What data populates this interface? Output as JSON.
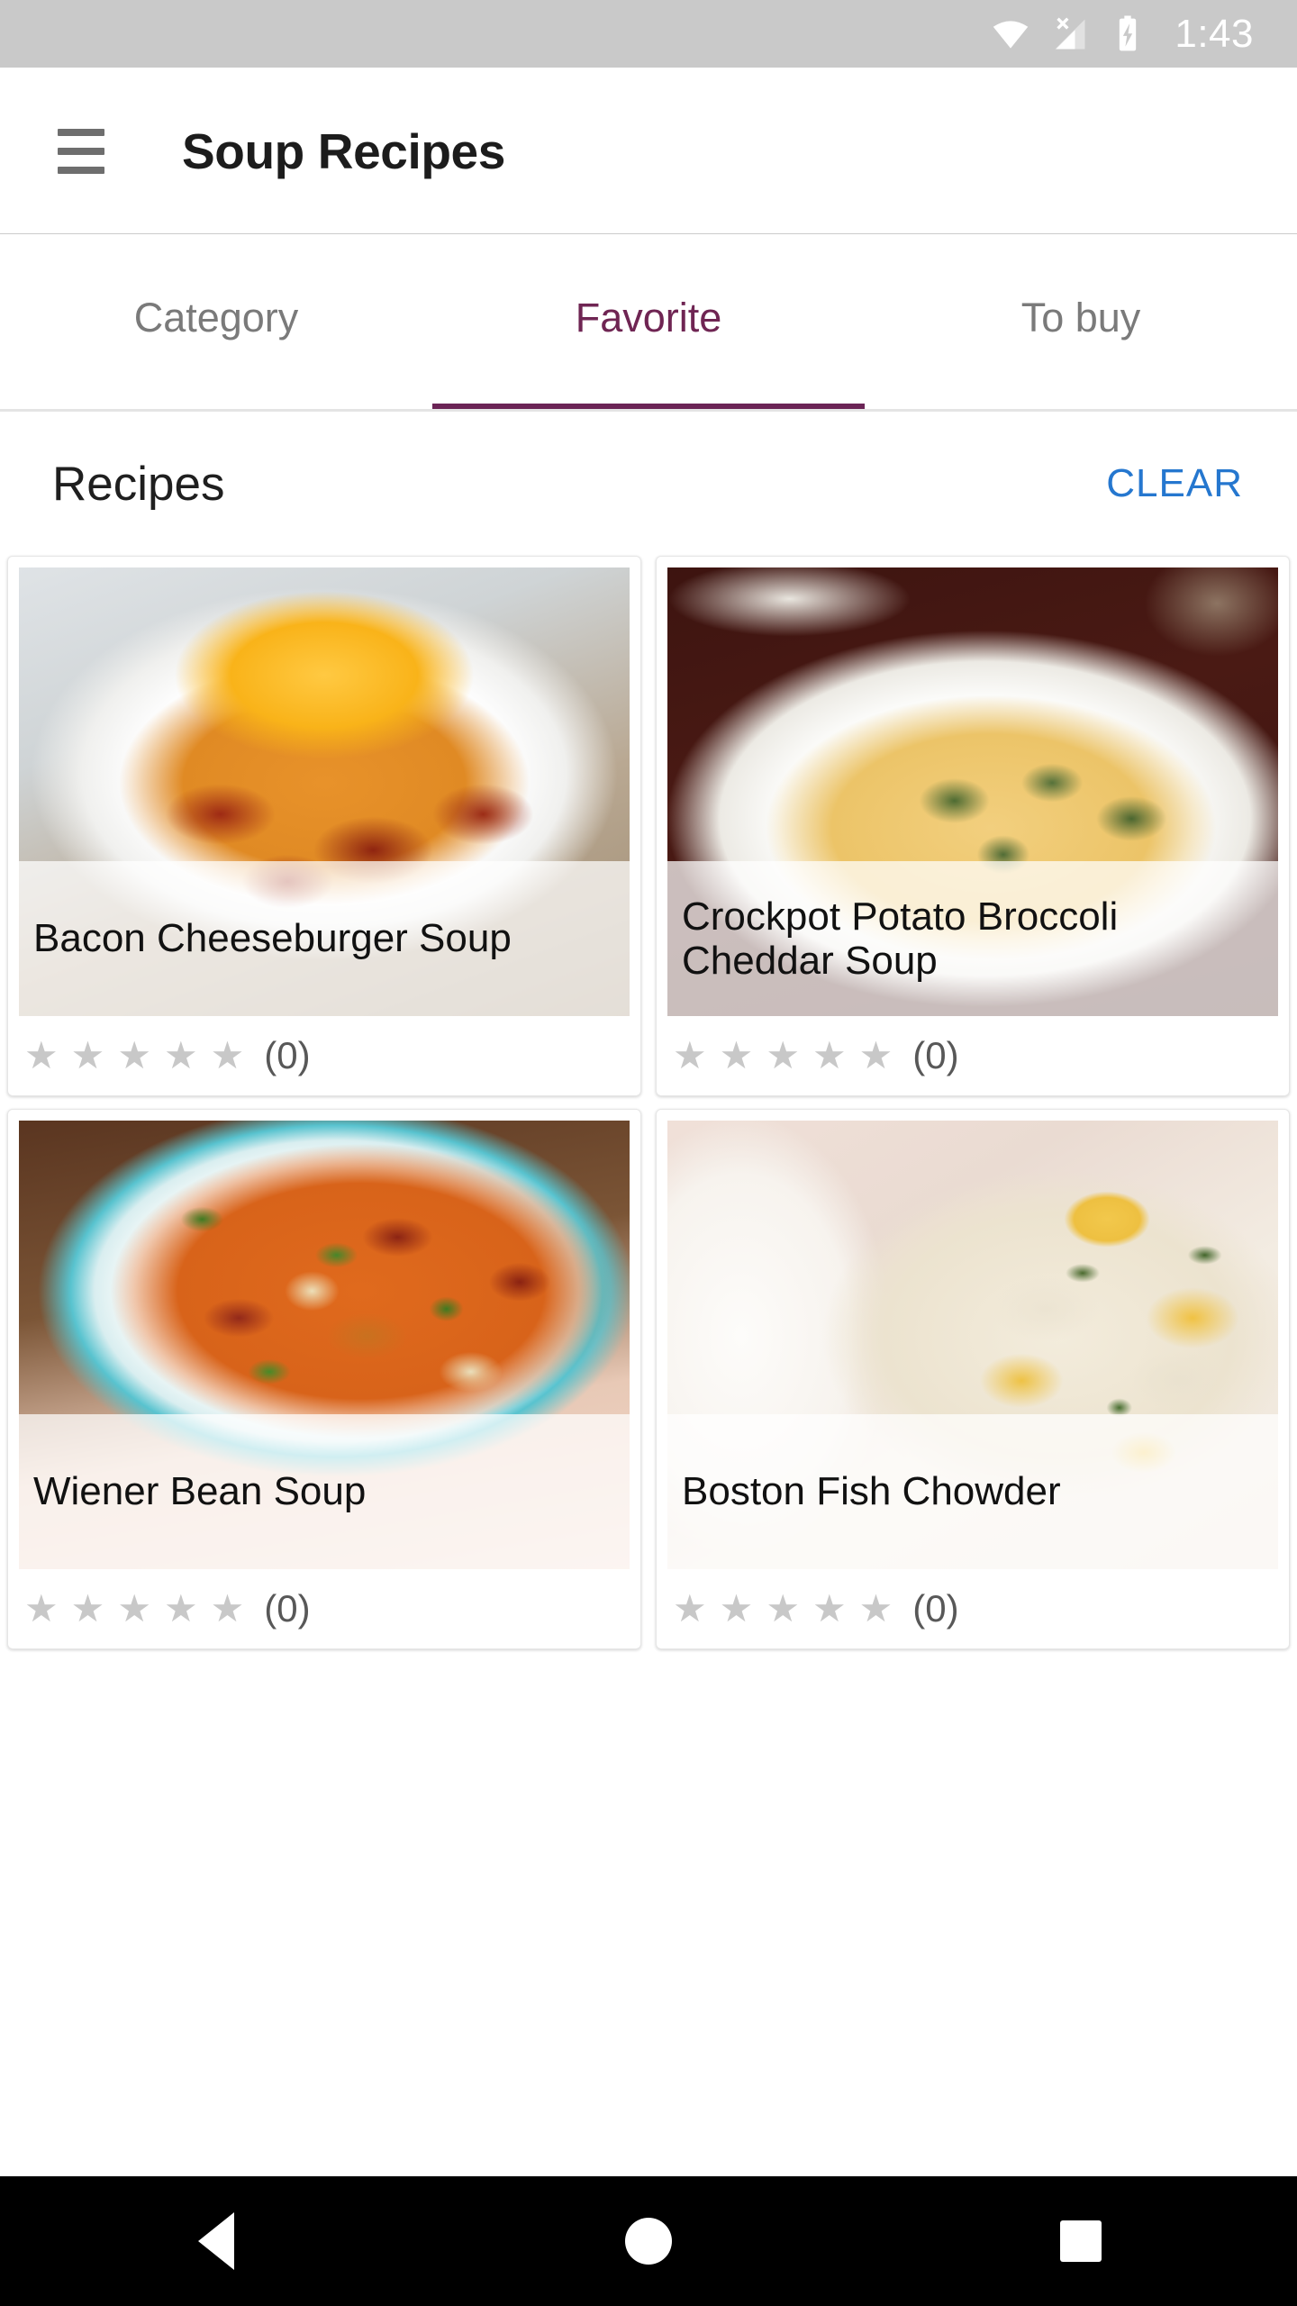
{
  "status_bar": {
    "time": "1:43",
    "icons": [
      "wifi-icon",
      "cellular-no-signal-icon",
      "battery-charging-icon"
    ],
    "background": "#c9c9c9"
  },
  "app_bar": {
    "menu_icon": "hamburger-menu-icon",
    "title": "Soup Recipes"
  },
  "tabs": {
    "items": [
      {
        "label": "Category",
        "active": false
      },
      {
        "label": "Favorite",
        "active": true
      },
      {
        "label": "To buy",
        "active": false
      }
    ],
    "active_color": "#6f2553",
    "inactive_color": "#7a7a7a",
    "indicator_color": "#6b2456"
  },
  "section": {
    "title": "Recipes",
    "clear_label": "CLEAR",
    "clear_color": "#2577cf"
  },
  "recipes": [
    {
      "title": "Bacon Cheeseburger Soup",
      "rating_count": "(0)",
      "stars": 5,
      "filled_stars": 0,
      "image_name": "bacon-cheeseburger-soup-photo"
    },
    {
      "title": "Crockpot Potato Broccoli Cheddar Soup",
      "rating_count": "(0)",
      "stars": 5,
      "filled_stars": 0,
      "image_name": "crockpot-potato-broccoli-cheddar-soup-photo"
    },
    {
      "title": "Wiener Bean Soup",
      "rating_count": "(0)",
      "stars": 5,
      "filled_stars": 0,
      "image_name": "wiener-bean-soup-photo"
    },
    {
      "title": "Boston Fish Chowder",
      "rating_count": "(0)",
      "stars": 5,
      "filled_stars": 0,
      "image_name": "boston-fish-chowder-photo"
    }
  ],
  "star_glyph": "★",
  "nav_bar": {
    "back_label": "back-icon",
    "home_label": "home-icon",
    "recents_label": "recents-icon"
  }
}
